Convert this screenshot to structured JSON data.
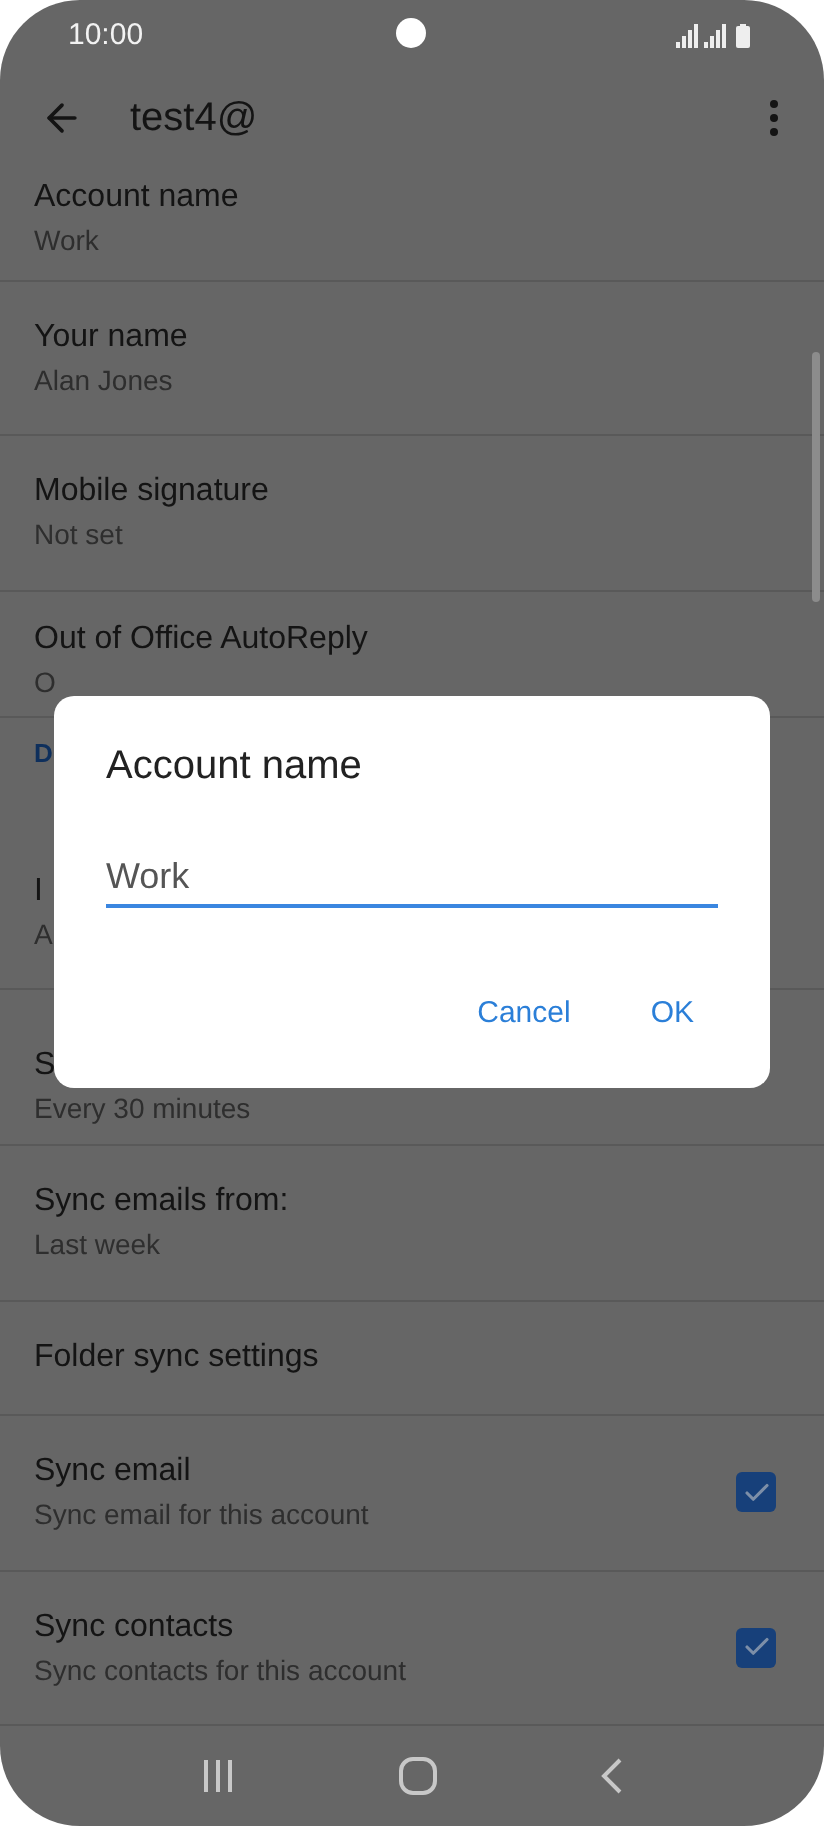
{
  "status_bar": {
    "time": "10:00"
  },
  "app_bar": {
    "title": "test4@"
  },
  "settings": [
    {
      "kind": "item",
      "title": "Account name",
      "subtitle": "Work"
    },
    {
      "kind": "item",
      "title": "Your name",
      "subtitle": "Alan Jones"
    },
    {
      "kind": "item",
      "title": "Mobile signature",
      "subtitle": "Not set"
    },
    {
      "kind": "item",
      "title": "Out of Office AutoReply",
      "subtitle": "O"
    },
    {
      "kind": "header",
      "title": "D"
    },
    {
      "kind": "item",
      "title": "I",
      "subtitle": "A"
    },
    {
      "kind": "item",
      "title": "S",
      "subtitle": "Every 30 minutes"
    },
    {
      "kind": "item",
      "title": "Sync emails from:",
      "subtitle": "Last week"
    },
    {
      "kind": "item",
      "title": "Folder sync settings"
    },
    {
      "kind": "checkbox",
      "title": "Sync email",
      "subtitle": "Sync email for this account",
      "checked": true
    },
    {
      "kind": "checkbox",
      "title": "Sync contacts",
      "subtitle": "Sync contacts for this account",
      "checked": true
    }
  ],
  "dialog": {
    "title": "Account name",
    "field": {
      "value": "Work"
    },
    "buttons": [
      "Cancel",
      "OK"
    ]
  }
}
